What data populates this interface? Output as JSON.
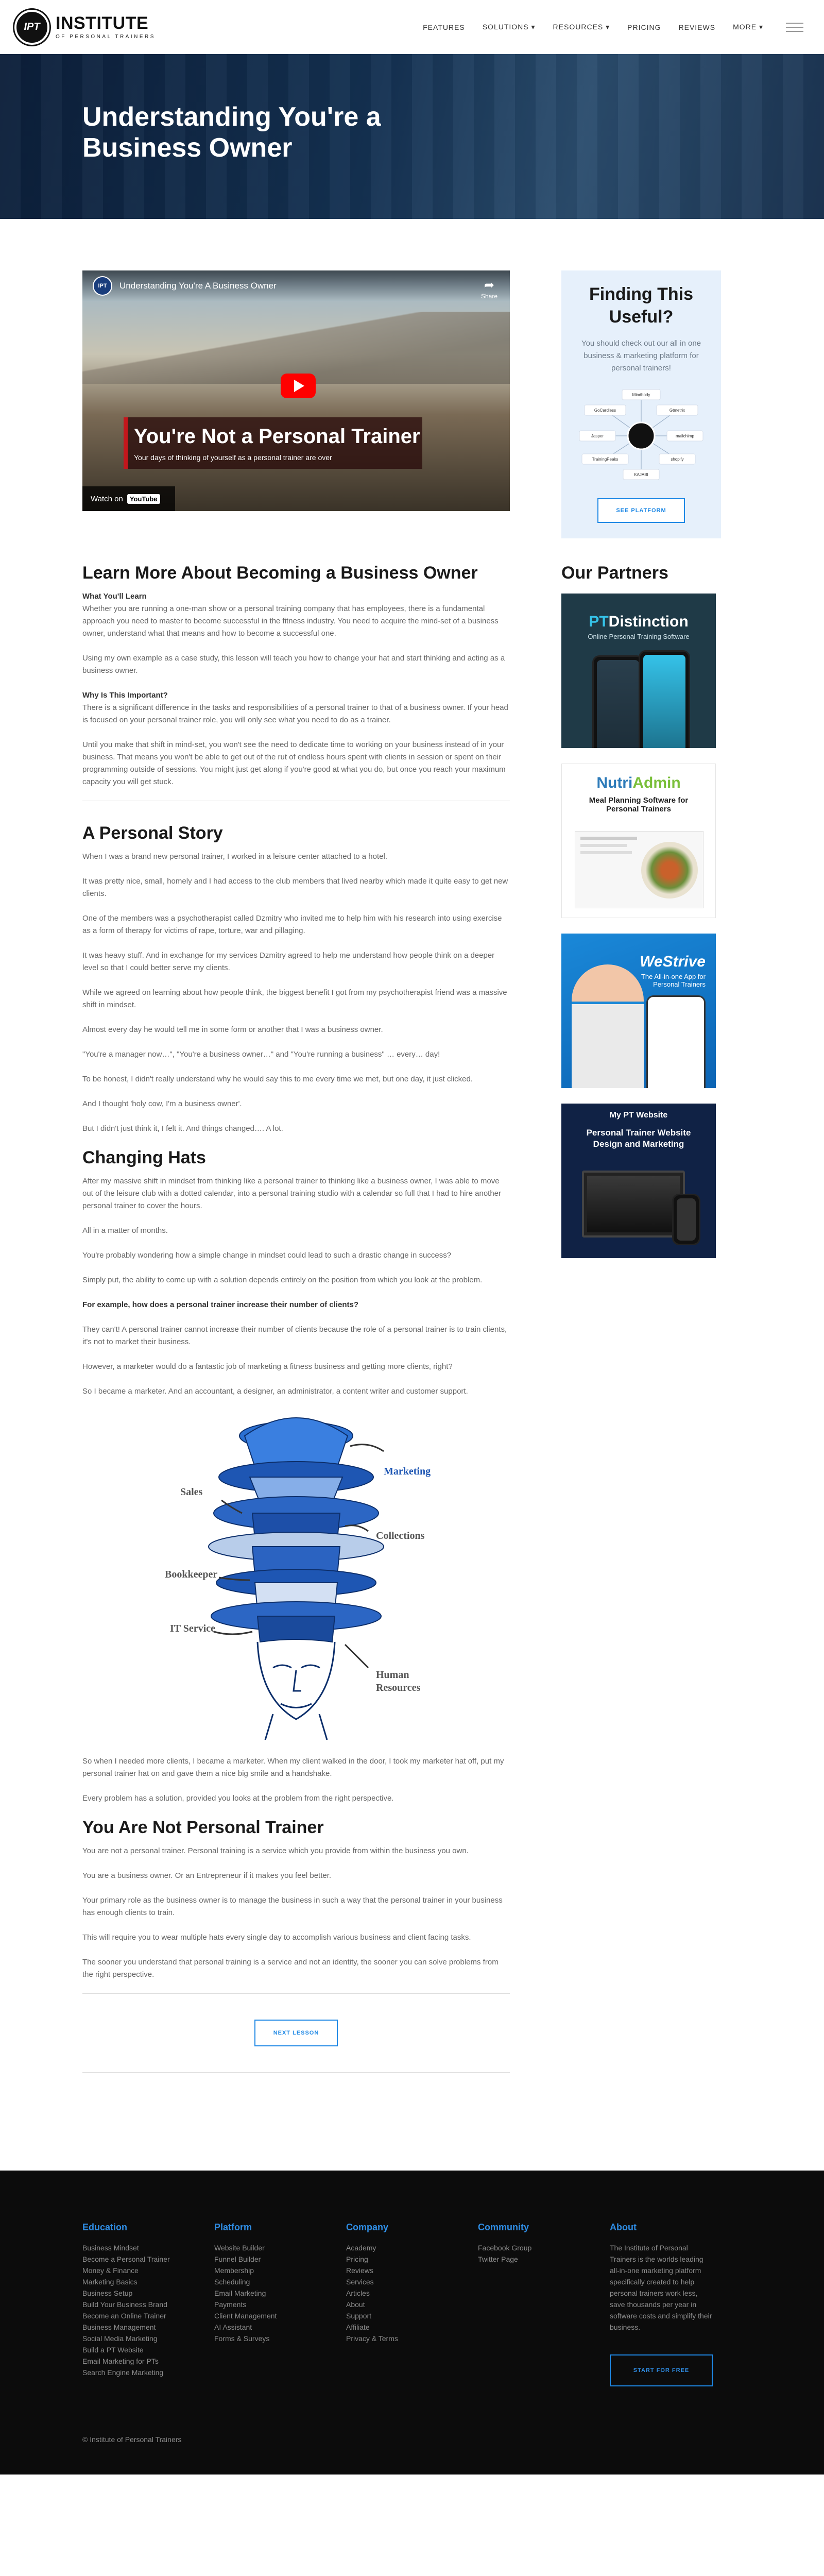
{
  "header": {
    "logo_abbr": "IPT",
    "logo_title": "INSTITUTE",
    "logo_subtitle": "OF PERSONAL TRAINERS",
    "nav": [
      "FEATURES",
      "SOLUTIONS ▾",
      "RESOURCES ▾",
      "PRICING",
      "REVIEWS",
      "MORE ▾"
    ]
  },
  "hero": {
    "title": "Understanding You're a Business Owner"
  },
  "video": {
    "channel_abbr": "IPT",
    "title": "Understanding You're A Business Owner",
    "share_label": "Share",
    "caption_title": "You're Not a Personal Trainer",
    "caption_sub": "Your days of thinking of yourself as a personal trainer are over",
    "watch_on": "Watch on",
    "youtube": "YouTube"
  },
  "article": {
    "s1_title": "Learn More About Becoming a Business Owner",
    "s1_learn_head": "What You'll Learn",
    "s1_p1": "Whether you are running a one-man show or a personal training company that has employees, there is a fundamental approach you need to master to become successful in the fitness industry. You need to acquire the mind-set of a business owner, understand what that means and how to become a successful one.",
    "s1_p2": "Using my own example as a case study, this lesson will teach you how to change your hat and start thinking and acting as a business owner.",
    "s1_why_head": "Why Is This Important?",
    "s1_p3": "There is a significant difference in the tasks and responsibilities of a personal trainer to that of a business owner. If your head is focused on your personal trainer role, you will only see what you need to do as a trainer.",
    "s1_p4": "Until you make that shift in mind-set, you won't see the need to dedicate time to working on your business instead of in your business. That means you won't be able to get out of the rut of endless hours spent with clients in session or spent on their programming outside of sessions. You might just get along if you're good at what you do, but once you reach your maximum capacity you will get stuck.",
    "s2_title": "A Personal Story",
    "s2_paras": [
      "When I was a brand new personal trainer, I worked in a leisure center attached to a hotel.",
      "It was pretty nice, small, homely and I had access to the club members that lived nearby which made it quite easy to get new clients.",
      "One of the members was a psychotherapist called Dzmitry who invited me to help him with his research into using exercise as a form of therapy for victims of rape, torture, war and pillaging.",
      "It was heavy stuff. And in exchange for my services Dzmitry agreed to help me understand how people think on a deeper level so that I could better serve my clients.",
      "While we agreed on learning about how people think, the biggest benefit I got from my psychotherapist friend was a massive shift in mindset.",
      "Almost every day he would tell me in some form or another that I was a business owner.",
      "\"You're a manager now…\", \"You're a business owner…\" and \"You're running a business\" … every… day!",
      "To be honest, I didn't really understand why he would say this to me every time we met, but one day, it just clicked.",
      "And I thought 'holy cow, I'm a business owner'.",
      "But I didn't just think it, I felt it. And things changed…. A lot."
    ],
    "s3_title": "Changing Hats",
    "s3_paras_a": [
      "After my massive shift in mindset from thinking like a personal trainer to thinking like a business owner, I was able to move out of the leisure club with a dotted calendar, into a personal training studio with a calendar so full that I had to hire another personal trainer to cover the hours.",
      "All in a matter of months.",
      "You're probably wondering how a simple change in mindset could lead to such a drastic change in success?",
      "Simply put, the ability to come up with a solution depends entirely on the position from which you look at the problem."
    ],
    "s3_question": "For example, how does a personal trainer increase their number of clients?",
    "s3_paras_b": [
      "They can't! A personal trainer cannot increase their number of clients because the role of a personal trainer is to train clients, it's not to market their business.",
      "However, a marketer would do a fantastic job of marketing a fitness business and getting more clients, right?",
      "So I became a marketer. And an accountant, a designer, an administrator, a content writer and customer support."
    ],
    "hats_labels": {
      "marketing": "Marketing",
      "sales": "Sales",
      "collections": "Collections",
      "bookkeeper": "Bookkeeper",
      "it": "IT Service",
      "hr1": "Human",
      "hr2": "Resources"
    },
    "s3_paras_c": [
      "So when I needed more clients, I became a marketer. When my client walked in the door, I took my marketer hat off, put my personal trainer hat on and gave them a nice big smile and a handshake.",
      "Every problem has a solution, provided you looks at the problem from the right perspective."
    ],
    "s4_title": "You Are Not Personal Trainer",
    "s4_paras": [
      "You are not a personal trainer. Personal training is a service which you provide from within the business you own.",
      "You are a business owner. Or an Entrepreneur if it makes you feel better.",
      "Your primary role as the business owner is to manage the business in such a way that the personal trainer in your business has enough clients to train.",
      "This will require you to wear multiple hats every single day to accomplish various business and client facing tasks.",
      "The sooner you understand that personal training is a service and not an identity, the sooner you can solve problems from the right perspective."
    ],
    "next_button": "NEXT LESSON"
  },
  "sidebar": {
    "promo_title": "Finding This Useful?",
    "promo_text": "You should check out our all in one business & marketing platform for personal trainers!",
    "promo_logos": [
      "Mindbody",
      "GoCardless",
      "Gtmetrix",
      "Jasper",
      "mailchimp",
      "TrainingPeaks",
      "shopify",
      "KAJABI"
    ],
    "promo_button": "SEE PLATFORM",
    "partners_title": "Our Partners",
    "partners": [
      {
        "name_a": "PT",
        "name_b": "Distinction",
        "sub": "Online Personal Training Software"
      },
      {
        "name_a": "Nutri",
        "name_b": "Admin",
        "sub": "Meal Planning Software for Personal Trainers"
      },
      {
        "name": "WeStrive",
        "sub": "The All-in-one App for Personal Trainers"
      },
      {
        "name": "My PT Website",
        "sub": "Personal Trainer Website Design and Marketing"
      }
    ]
  },
  "footer": {
    "education_title": "Education",
    "education": [
      "Business Mindset",
      "Become a Personal Trainer",
      "Money & Finance",
      "Marketing Basics",
      "Business Setup",
      "Build Your Business Brand",
      "Become an Online Trainer",
      "Business Management",
      "Social Media Marketing",
      "Build a PT Website",
      "Email Marketing for PTs",
      "Search Engine Marketing"
    ],
    "platform_title": "Platform",
    "platform": [
      "Website Builder",
      "Funnel Builder",
      "Membership",
      "Scheduling",
      "Email Marketing",
      "Payments",
      "Client Management",
      "AI Assistant",
      "Forms & Surveys"
    ],
    "company_title": "Company",
    "company": [
      "Academy",
      "Pricing",
      "Reviews",
      "Services",
      "Articles",
      "About",
      "Support",
      "Affiliate",
      "Privacy & Terms"
    ],
    "community_title": "Community",
    "community": [
      "Facebook Group",
      "Twitter Page"
    ],
    "about_title": "About",
    "about_text": "The Institute of Personal Trainers is the worlds leading all-in-one marketing platform specifically created to help personal trainers work less, save thousands per year in software costs and simplify their business.",
    "start_button": "START FOR FREE",
    "copyright": "© Institute of Personal Trainers"
  }
}
